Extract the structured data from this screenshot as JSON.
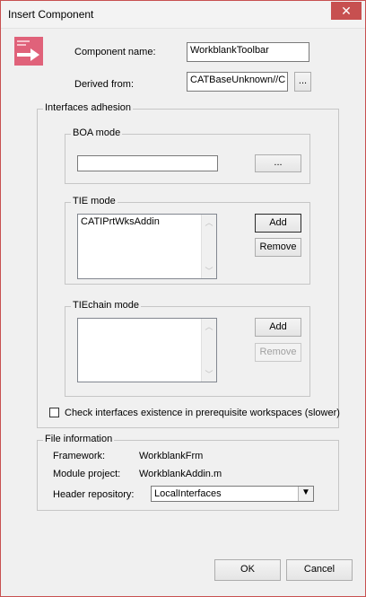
{
  "window": {
    "title": "Insert Component",
    "close_glyph": "✕"
  },
  "header": {
    "icon": "insert-component-icon",
    "component_name_label": "Component name:",
    "component_name_value": "WorkblankToolbar",
    "derived_from_label": "Derived from:",
    "derived_from_value": "CATBaseUnknown//C",
    "browse_label": "..."
  },
  "interfaces": {
    "title": "Interfaces adhesion",
    "boa": {
      "title": "BOA mode",
      "value": "",
      "browse_label": "..."
    },
    "tie": {
      "title": "TIE mode",
      "items": [
        "CATIPrtWksAddin"
      ],
      "add_label": "Add",
      "remove_label": "Remove"
    },
    "tiechain": {
      "title": "TIEchain mode",
      "items": [],
      "add_label": "Add",
      "remove_label": "Remove"
    },
    "check_label": "Check interfaces existence in prerequisite workspaces (slower)",
    "check_checked": false
  },
  "file_info": {
    "title": "File information",
    "framework_label": "Framework:",
    "framework_value": "WorkblankFrm",
    "module_label": "Module project:",
    "module_value": "WorkblankAddin.m",
    "header_repo_label": "Header repository:",
    "header_repo_value": "LocalInterfaces"
  },
  "footer": {
    "ok_label": "OK",
    "cancel_label": "Cancel"
  }
}
